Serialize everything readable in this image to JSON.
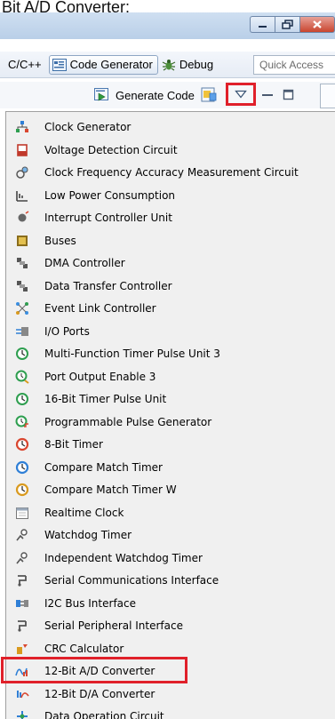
{
  "caption": {
    "text": "Bit A/D Converter:"
  },
  "perspectives": {
    "cc": "C/C++",
    "code_generator": "Code Generator",
    "debug": "Debug",
    "quick_access": "Quick Access"
  },
  "toolbar": {
    "generate_code": "Generate Code"
  },
  "menu": {
    "items": [
      {
        "label": "Clock Generator",
        "icon": "clock-generator-icon",
        "color": "#2f7fd6"
      },
      {
        "label": "Voltage Detection Circuit",
        "icon": "voltage-detection-icon",
        "color": "#c0392b"
      },
      {
        "label": "Clock Frequency Accuracy Measurement Circuit",
        "icon": "clock-frequency-icon",
        "color": "#555555"
      },
      {
        "label": "Low Power Consumption",
        "icon": "low-power-icon",
        "color": "#444444"
      },
      {
        "label": "Interrupt Controller Unit",
        "icon": "interrupt-controller-icon",
        "color": "#666666"
      },
      {
        "label": "Buses",
        "icon": "buses-icon",
        "color": "#8a6d1c"
      },
      {
        "label": "DMA Controller",
        "icon": "dma-controller-icon",
        "color": "#555555"
      },
      {
        "label": "Data Transfer Controller",
        "icon": "data-transfer-controller-icon",
        "color": "#555555"
      },
      {
        "label": "Event Link Controller",
        "icon": "event-link-controller-icon",
        "color": "#3a8ee0"
      },
      {
        "label": "I/O Ports",
        "icon": "io-ports-icon",
        "color": "#2f7fd6"
      },
      {
        "label": "Multi-Function Timer Pulse Unit 3",
        "icon": "mtu3-timer-icon",
        "color": "#2e9e4f"
      },
      {
        "label": "Port Output Enable 3",
        "icon": "port-output-enable-icon",
        "color": "#2e9e4f"
      },
      {
        "label": "16-Bit Timer Pulse Unit",
        "icon": "tpu-timer-icon",
        "color": "#2e9e4f"
      },
      {
        "label": "Programmable Pulse Generator",
        "icon": "pulse-generator-icon",
        "color": "#2e9e4f"
      },
      {
        "label": "8-Bit Timer",
        "icon": "8bit-timer-icon",
        "color": "#d9462f"
      },
      {
        "label": "Compare Match Timer",
        "icon": "compare-match-timer-icon",
        "color": "#2f7fd6"
      },
      {
        "label": "Compare Match Timer W",
        "icon": "compare-match-timer-w-icon",
        "color": "#d99a1f"
      },
      {
        "label": "Realtime Clock",
        "icon": "realtime-clock-icon",
        "color": "#777777"
      },
      {
        "label": "Watchdog Timer",
        "icon": "watchdog-timer-icon",
        "color": "#555555"
      },
      {
        "label": "Independent Watchdog Timer",
        "icon": "independent-watchdog-icon",
        "color": "#555555"
      },
      {
        "label": "Serial Communications Interface",
        "icon": "serial-comm-icon",
        "color": "#555555"
      },
      {
        "label": "I2C Bus Interface",
        "icon": "i2c-bus-icon",
        "color": "#2f7fd6"
      },
      {
        "label": "Serial Peripheral Interface",
        "icon": "spi-icon",
        "color": "#555555"
      },
      {
        "label": "CRC Calculator",
        "icon": "crc-calculator-icon",
        "color": "#d99a1f"
      },
      {
        "label": "12-Bit A/D Converter",
        "icon": "ad-converter-icon",
        "color": "#d9462f"
      },
      {
        "label": "12-Bit D/A Converter",
        "icon": "da-converter-icon",
        "color": "#d9462f"
      },
      {
        "label": "Data Operation Circuit",
        "icon": "data-operation-icon",
        "color": "#2f7fd6"
      }
    ]
  },
  "highlight_color": "#e0202a"
}
